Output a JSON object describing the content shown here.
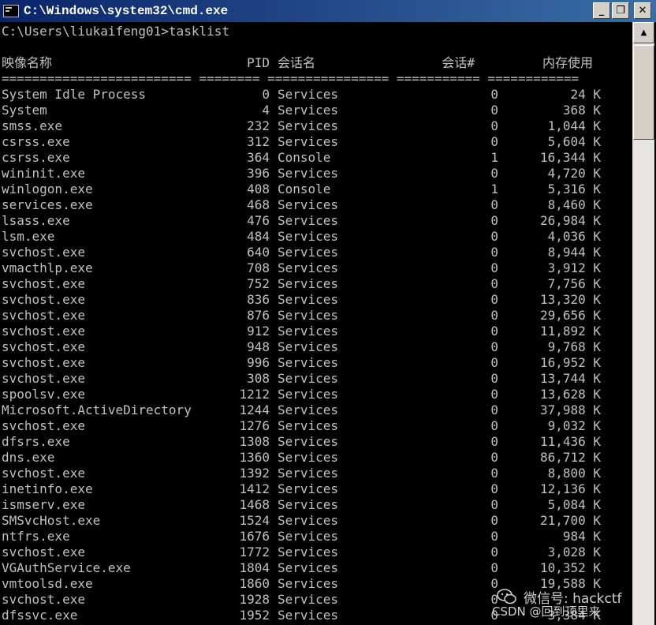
{
  "window": {
    "title": "C:\\Windows\\system32\\cmd.exe",
    "minimize_glyph": "_",
    "maximize_glyph": "❐",
    "close_glyph": "✕"
  },
  "console": {
    "prompt": "C:\\Users\\liukaifeng01>tasklist",
    "headers": {
      "image_name": "映像名称",
      "pid": "PID",
      "session_name": "会话名",
      "session_num": "会话#",
      "mem_usage": "内存使用"
    },
    "separator": "========================= ======== ================ =========== ============",
    "rows": [
      {
        "name": "System Idle Process",
        "pid": "0",
        "session": "Services",
        "num": "0",
        "mem": "24 K"
      },
      {
        "name": "System",
        "pid": "4",
        "session": "Services",
        "num": "0",
        "mem": "368 K"
      },
      {
        "name": "smss.exe",
        "pid": "232",
        "session": "Services",
        "num": "0",
        "mem": "1,044 K"
      },
      {
        "name": "csrss.exe",
        "pid": "312",
        "session": "Services",
        "num": "0",
        "mem": "5,604 K"
      },
      {
        "name": "csrss.exe",
        "pid": "364",
        "session": "Console",
        "num": "1",
        "mem": "16,344 K"
      },
      {
        "name": "wininit.exe",
        "pid": "396",
        "session": "Services",
        "num": "0",
        "mem": "4,720 K"
      },
      {
        "name": "winlogon.exe",
        "pid": "408",
        "session": "Console",
        "num": "1",
        "mem": "5,316 K"
      },
      {
        "name": "services.exe",
        "pid": "468",
        "session": "Services",
        "num": "0",
        "mem": "8,460 K"
      },
      {
        "name": "lsass.exe",
        "pid": "476",
        "session": "Services",
        "num": "0",
        "mem": "26,984 K"
      },
      {
        "name": "lsm.exe",
        "pid": "484",
        "session": "Services",
        "num": "0",
        "mem": "4,036 K"
      },
      {
        "name": "svchost.exe",
        "pid": "640",
        "session": "Services",
        "num": "0",
        "mem": "8,944 K"
      },
      {
        "name": "vmacthlp.exe",
        "pid": "708",
        "session": "Services",
        "num": "0",
        "mem": "3,912 K"
      },
      {
        "name": "svchost.exe",
        "pid": "752",
        "session": "Services",
        "num": "0",
        "mem": "7,756 K"
      },
      {
        "name": "svchost.exe",
        "pid": "836",
        "session": "Services",
        "num": "0",
        "mem": "13,320 K"
      },
      {
        "name": "svchost.exe",
        "pid": "876",
        "session": "Services",
        "num": "0",
        "mem": "29,656 K"
      },
      {
        "name": "svchost.exe",
        "pid": "912",
        "session": "Services",
        "num": "0",
        "mem": "11,892 K"
      },
      {
        "name": "svchost.exe",
        "pid": "948",
        "session": "Services",
        "num": "0",
        "mem": "9,768 K"
      },
      {
        "name": "svchost.exe",
        "pid": "996",
        "session": "Services",
        "num": "0",
        "mem": "16,952 K"
      },
      {
        "name": "svchost.exe",
        "pid": "308",
        "session": "Services",
        "num": "0",
        "mem": "13,744 K"
      },
      {
        "name": "spoolsv.exe",
        "pid": "1212",
        "session": "Services",
        "num": "0",
        "mem": "13,628 K"
      },
      {
        "name": "Microsoft.ActiveDirectory",
        "pid": "1244",
        "session": "Services",
        "num": "0",
        "mem": "37,988 K"
      },
      {
        "name": "svchost.exe",
        "pid": "1276",
        "session": "Services",
        "num": "0",
        "mem": "9,032 K"
      },
      {
        "name": "dfsrs.exe",
        "pid": "1308",
        "session": "Services",
        "num": "0",
        "mem": "11,436 K"
      },
      {
        "name": "dns.exe",
        "pid": "1360",
        "session": "Services",
        "num": "0",
        "mem": "86,712 K"
      },
      {
        "name": "svchost.exe",
        "pid": "1392",
        "session": "Services",
        "num": "0",
        "mem": "8,800 K"
      },
      {
        "name": "inetinfo.exe",
        "pid": "1412",
        "session": "Services",
        "num": "0",
        "mem": "12,136 K"
      },
      {
        "name": "ismserv.exe",
        "pid": "1468",
        "session": "Services",
        "num": "0",
        "mem": "5,084 K"
      },
      {
        "name": "SMSvcHost.exe",
        "pid": "1524",
        "session": "Services",
        "num": "0",
        "mem": "21,700 K"
      },
      {
        "name": "ntfrs.exe",
        "pid": "1676",
        "session": "Services",
        "num": "0",
        "mem": "984 K"
      },
      {
        "name": "svchost.exe",
        "pid": "1772",
        "session": "Services",
        "num": "0",
        "mem": "3,028 K"
      },
      {
        "name": "VGAuthService.exe",
        "pid": "1804",
        "session": "Services",
        "num": "0",
        "mem": "10,352 K"
      },
      {
        "name": "vmtoolsd.exe",
        "pid": "1860",
        "session": "Services",
        "num": "0",
        "mem": "19,588 K"
      },
      {
        "name": "svchost.exe",
        "pid": "1928",
        "session": "Services",
        "num": "0",
        "mem": ""
      },
      {
        "name": "dfssvc.exe",
        "pid": "1952",
        "session": "Services",
        "num": "0",
        "mem": "3,384 K"
      }
    ]
  },
  "watermark": {
    "line1": "微信号: hackctf",
    "line2": "CSDN @回到顶里来"
  },
  "colors": {
    "console_bg": "#000000",
    "console_text": "#c0c0c0",
    "titlebar_start": "#0a246a",
    "titlebar_end": "#3a6ea5"
  }
}
